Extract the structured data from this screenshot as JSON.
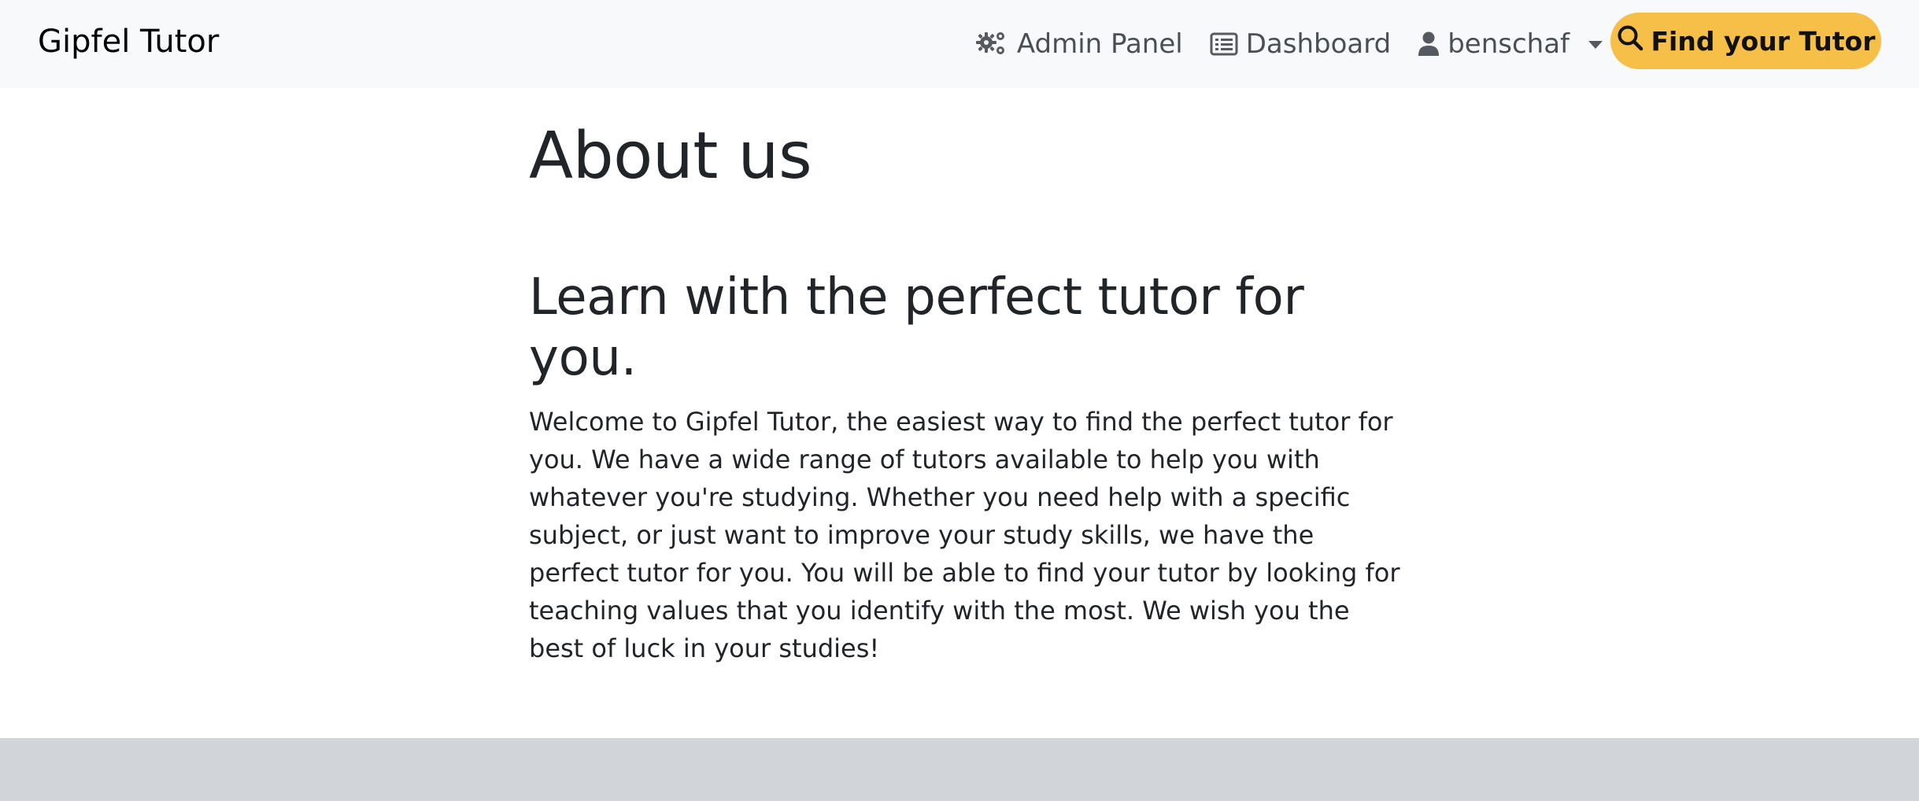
{
  "navbar": {
    "brand": "Gipfel Tutor",
    "admin_panel_label": "Admin Panel",
    "dashboard_label": "Dashboard",
    "user_label": "benschaf",
    "find_tutor_label": "Find your Tutor",
    "icons": {
      "admin": "gears-icon",
      "dashboard": "list-icon",
      "user": "user-icon",
      "dropdown": "caret-down-icon",
      "search": "search-icon"
    }
  },
  "main": {
    "title": "About us",
    "subtitle": "Learn with the perfect tutor for you.",
    "body": "Welcome to Gipfel Tutor, the easiest way to find the perfect tutor for you. We have a wide range of tutors available to help you with whatever you're studying. Whether you need help with a specific subject, or just want to improve your study skills, we have the perfect tutor for you. You will be able to find your tutor by looking for teaching values that you identify with the most. We wish you the best of luck in your studies!"
  },
  "colors": {
    "navbar_bg": "#f8f9fa",
    "accent": "#f6bf47",
    "footer_bg": "#d1d5d9",
    "text": "#212529"
  }
}
